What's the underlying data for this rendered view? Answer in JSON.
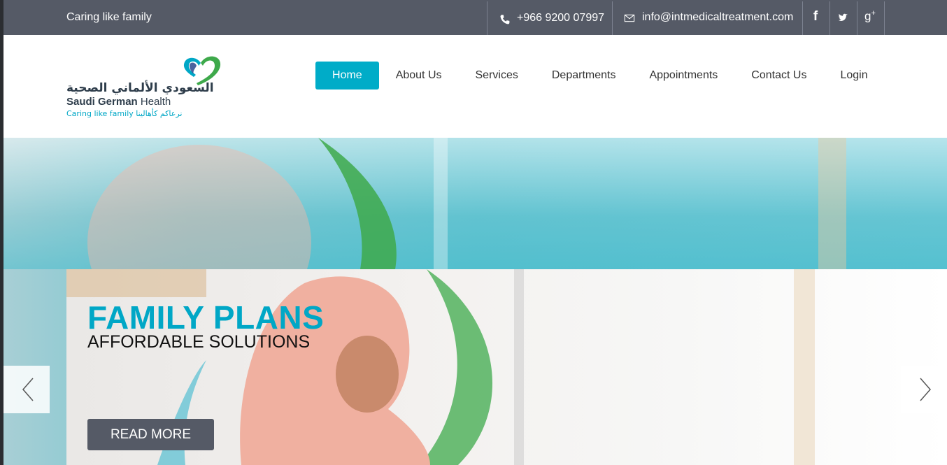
{
  "topbar": {
    "tagline": "Caring like family",
    "phone": "+966 9200 07997",
    "email": "info@intmedicaltreatment.com",
    "social": [
      "facebook-icon",
      "twitter-icon",
      "google-plus-icon"
    ]
  },
  "logo": {
    "arabic": "السعودي الألماني الصحية",
    "name_bold": "Saudi German",
    "name_rest": "Health",
    "tagline": "Caring like family  نرعاكم كأهالينا"
  },
  "nav": {
    "items": [
      "Home",
      "About Us",
      "Services",
      "Departments",
      "Appointments",
      "Contact Us",
      "Login"
    ],
    "active": "Home"
  },
  "hero": {
    "title": "FAMILY PLANS",
    "subtitle": "AFFORDABLE SOLUTIONS",
    "button": "READ MORE"
  },
  "colors": {
    "topbar": "#555a66",
    "accent": "#00acc8",
    "green": "#3ea94b"
  }
}
